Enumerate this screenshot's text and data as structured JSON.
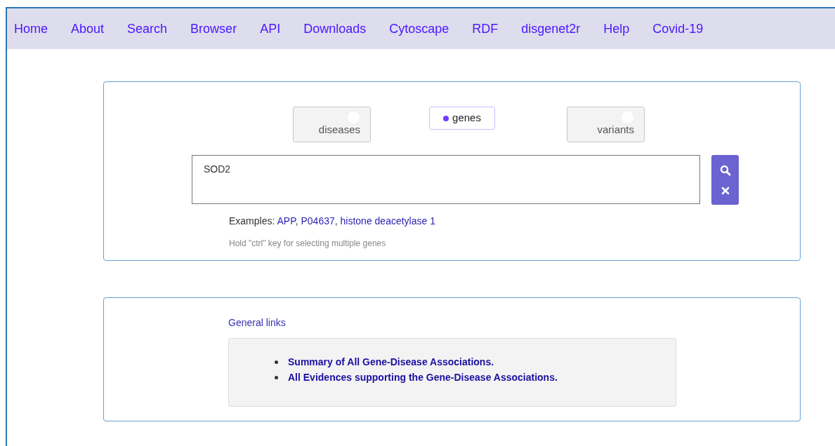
{
  "nav": [
    {
      "label": "Home"
    },
    {
      "label": "About"
    },
    {
      "label": "Search"
    },
    {
      "label": "Browser"
    },
    {
      "label": "API"
    },
    {
      "label": "Downloads"
    },
    {
      "label": "Cytoscape"
    },
    {
      "label": "RDF"
    },
    {
      "label": "disgenet2r"
    },
    {
      "label": "Help"
    },
    {
      "label": "Covid-19"
    }
  ],
  "search": {
    "options": [
      {
        "label": "diseases",
        "selected": false
      },
      {
        "label": "genes",
        "selected": true
      },
      {
        "label": "variants",
        "selected": false
      }
    ],
    "value": "SOD2",
    "examples_label": "Examples:",
    "examples": [
      "APP",
      "P04637",
      "histone deacetylase 1"
    ],
    "examples_separator": ",",
    "hint": "Hold \"ctrl\" key for selecting multiple genes"
  },
  "general_links": {
    "title": "General links",
    "items": [
      "Summary of All Gene-Disease Associations.",
      "All Evidences supporting the Gene-Disease Associations."
    ]
  }
}
